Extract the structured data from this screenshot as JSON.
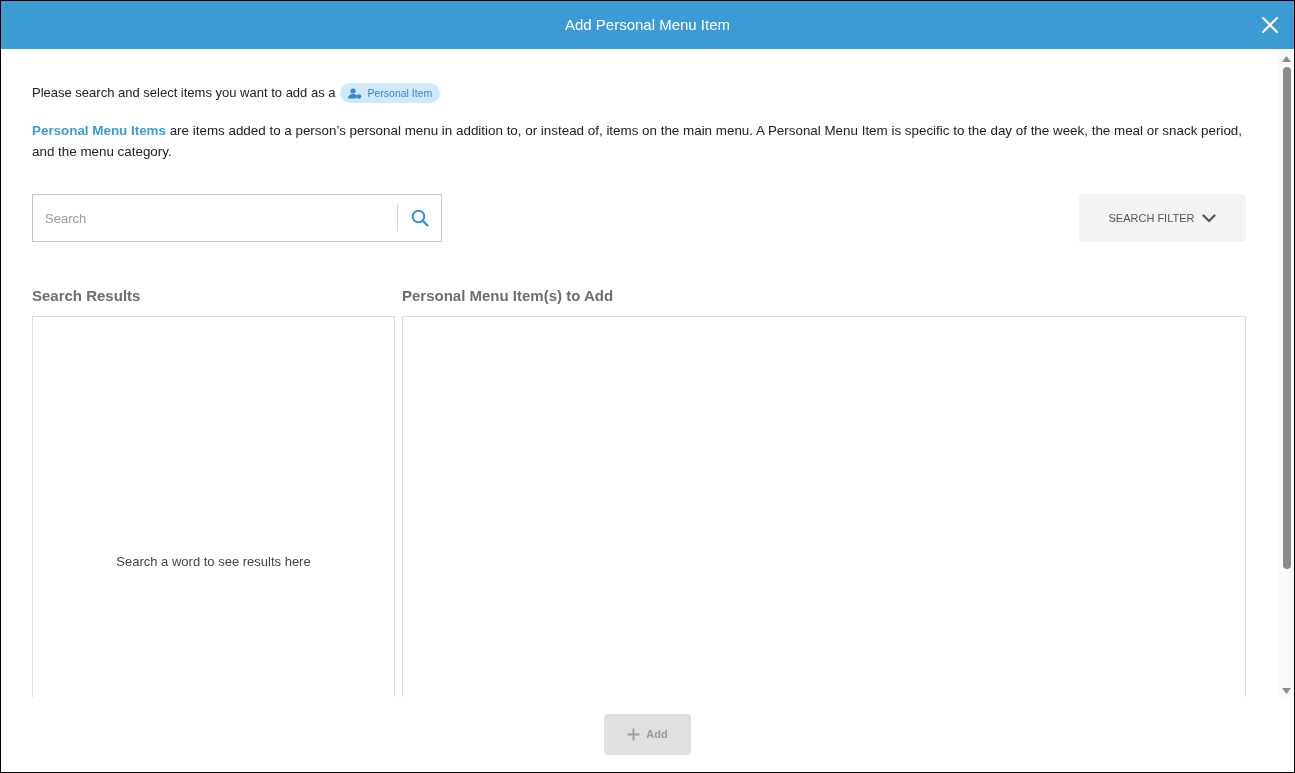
{
  "window": {
    "title": "Add Personal Menu Item"
  },
  "intro": {
    "text": "Please search and select items you want to add as a",
    "tag": "Personal Item"
  },
  "description": "**Personal Menu Items** are items added to a person’s personal menu in addition to, or instead of, items on the main menu. A Personal Menu Item is specific to the day of the week, the meal or snack period, and the menu category.",
  "search": {
    "placeholder": "Search"
  },
  "search_filter": {
    "label": "SEARCH FILTER",
    "expanded": false
  },
  "search_results": {
    "heading": "Search Results",
    "empty_message": "Search a word to see results here"
  },
  "items_to_add": {
    "heading": "Personal Menu Item(s) to Add"
  },
  "buttons": [
    {
      "label": "Add",
      "disabled": true
    }
  ]
}
